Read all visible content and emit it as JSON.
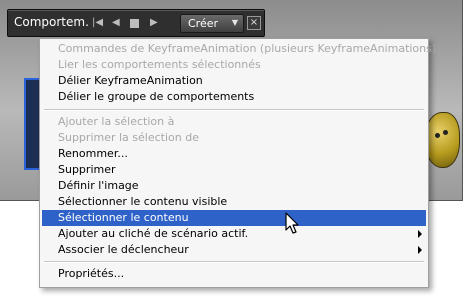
{
  "toolbar": {
    "title": "Comportem.",
    "first_icon": "skip-to-start-icon",
    "prev_icon": "step-back-icon",
    "stop_icon": "stop-icon",
    "next_icon": "play-icon",
    "create_label": "Créer",
    "close_label": "×"
  },
  "menu": {
    "items": [
      {
        "label": "Commandes de KeyframeAnimation (plusieurs KeyframeAnimations)",
        "enabled": false
      },
      {
        "label": "Lier les comportements sélectionnés",
        "enabled": false
      },
      {
        "label": "Délier KeyframeAnimation",
        "enabled": true
      },
      {
        "label": "Délier le groupe de  comportements",
        "enabled": true
      },
      {
        "label": "Ajouter la sélection à",
        "enabled": false
      },
      {
        "label": "Supprimer la sélection de",
        "enabled": false
      },
      {
        "label": "Renommer...",
        "enabled": true
      },
      {
        "label": "Supprimer",
        "enabled": true
      },
      {
        "label": "Définir l'image",
        "enabled": true
      },
      {
        "label": "Sélectionner le contenu visible",
        "enabled": true
      },
      {
        "label": "Sélectionner le contenu",
        "enabled": true,
        "highlighted": true
      },
      {
        "label": "Ajouter au cliché de scénario actif.",
        "enabled": true,
        "submenu": true
      },
      {
        "label": "Associer le déclencheur",
        "enabled": true,
        "submenu": true
      },
      {
        "label": "Propriétés...",
        "enabled": true
      }
    ]
  },
  "colors": {
    "highlight": "#2f62c8",
    "disabled_text": "#a8a8a8",
    "toolbar_bg": "#2f2f2f"
  }
}
